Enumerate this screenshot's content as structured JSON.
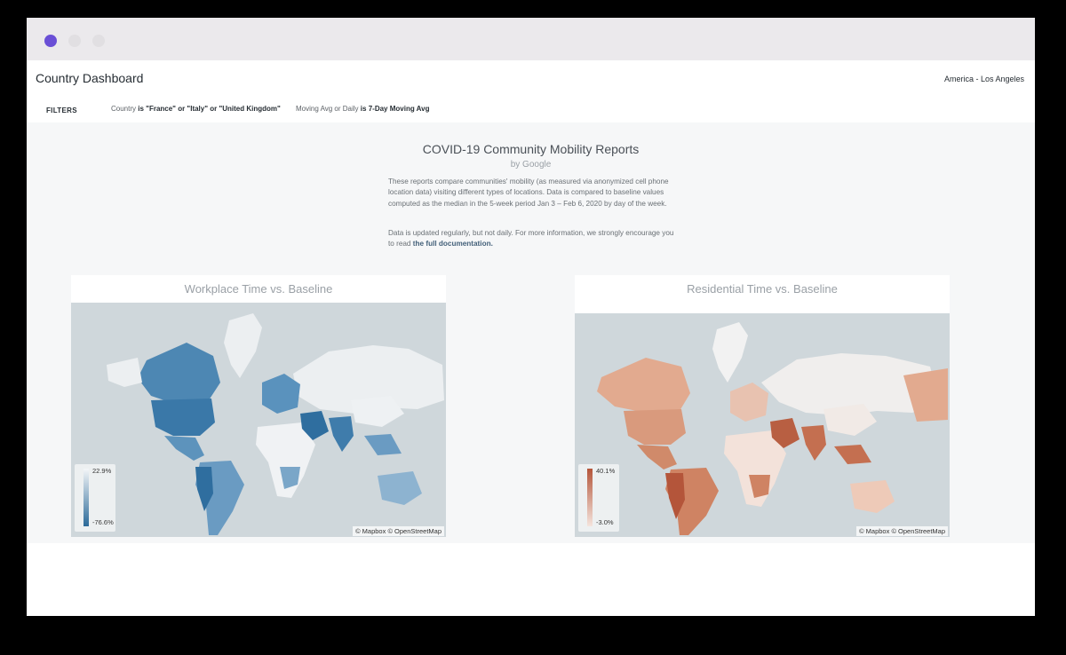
{
  "window": {
    "controls": [
      "close-button",
      "minimize-button",
      "maximize-button"
    ],
    "accent_color": "#6a4fd6"
  },
  "header": {
    "title": "Country Dashboard",
    "timezone": "America - Los Angeles"
  },
  "filters": {
    "label": "FILTERS",
    "items": [
      {
        "field": "Country",
        "operator": "is",
        "value": "\"France\" or \"Italy\" or \"United Kingdom\""
      },
      {
        "field": "Moving Avg or Daily",
        "operator": "is",
        "value": "7-Day Moving Avg"
      }
    ]
  },
  "report": {
    "title": "COVID-19 Community Mobility Reports",
    "subtitle": "by Google",
    "description": "These reports compare communities' mobility (as measured via anonymized cell phone location data) visiting different types of locations. Data is compared to baseline values computed as the median in the 5-week period Jan 3 – Feb 6, 2020 by day of the week.",
    "note": "Data is updated regularly, but not daily. For more information, we strongly encourage you to read",
    "link_text": "the full documentation."
  },
  "tiles": [
    {
      "title": "Workplace Time vs. Baseline",
      "legend_max": "22.9%",
      "legend_min": "-76.6%",
      "attribution": "© Mapbox © OpenStreetMap",
      "color_low": "#2b6a99",
      "color_high": "#f4f6f8"
    },
    {
      "title": "Residential Time vs. Baseline",
      "legend_max": "40.1%",
      "legend_min": "-3.0%",
      "attribution": "© Mapbox © OpenStreetMap",
      "color_low": "#f4e4dd",
      "color_high": "#b4553a"
    }
  ]
}
